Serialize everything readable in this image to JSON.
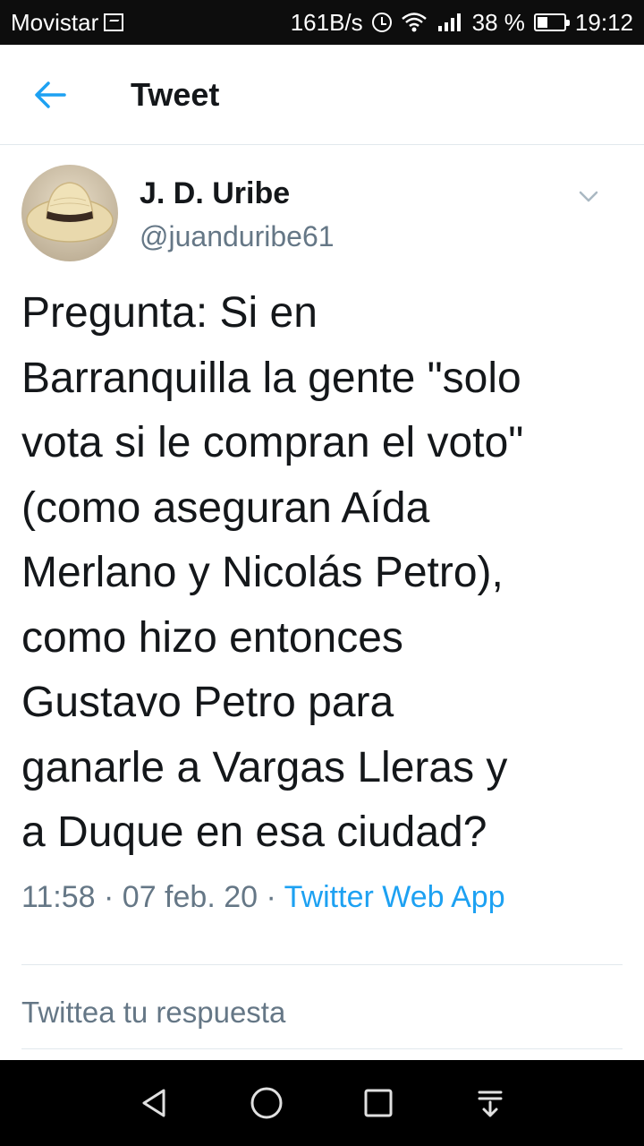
{
  "status_bar": {
    "carrier": "Movistar",
    "speed": "161B/s",
    "battery": "38 %",
    "battery_level": 0.38,
    "time": "19:12",
    "icons": [
      "photo-icon",
      "alarm-icon",
      "wifi-icon",
      "signal-icon",
      "battery-icon"
    ]
  },
  "header": {
    "title": "Tweet",
    "back_icon": "arrow-left-icon"
  },
  "tweet": {
    "display_name": "J. D. Uribe",
    "handle": "@juanduribe61",
    "text": "Pregunta: Si en\nBarranquilla la gente \"solo\nvota si le compran el voto\"\n(como aseguran Aída\nMerlano y Nicolás Petro),\ncomo hizo entonces\nGustavo Petro para\nganarle a Vargas Lleras y\na Duque en esa ciudad?",
    "time": "11:58",
    "separator": "·",
    "date": "07 feb. 20",
    "source": "Twitter Web App"
  },
  "reply": {
    "placeholder": "Twittea tu respuesta"
  },
  "nav_bar": {
    "icons": [
      "back-triangle-icon",
      "home-circle-icon",
      "recents-square-icon",
      "notifications-pull-icon"
    ]
  },
  "colors": {
    "accent": "#1da1f2",
    "secondary_text": "#657786",
    "primary_text": "#14171a"
  }
}
